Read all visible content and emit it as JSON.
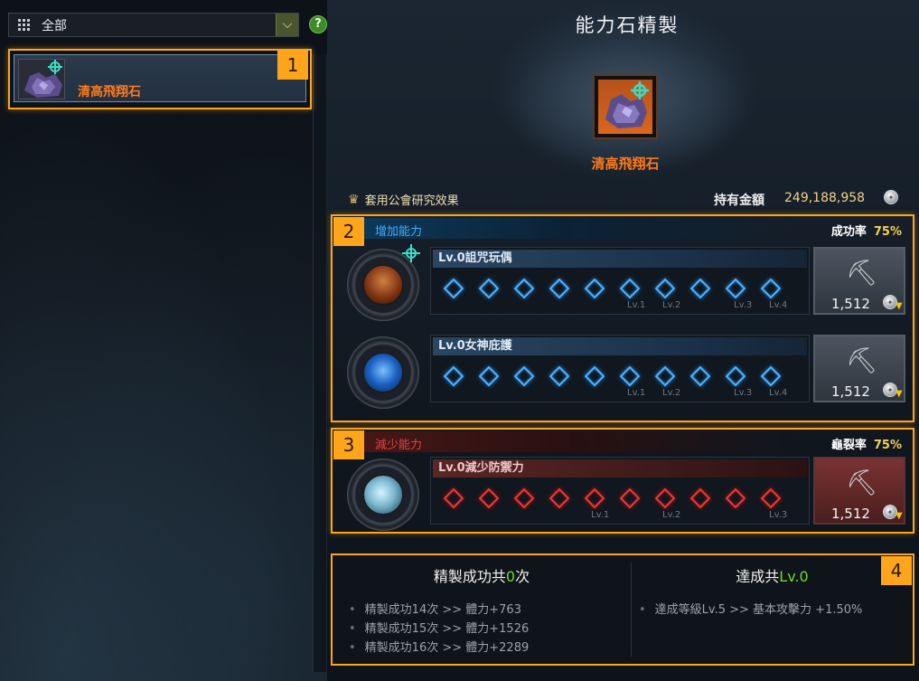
{
  "filter": {
    "label": "全部",
    "dropdown_icon": "chevron-down-icon",
    "help": "?"
  },
  "list": {
    "items": [
      {
        "name": "清高飛翔石",
        "badge": "1"
      }
    ]
  },
  "header": {
    "title": "能力石精製",
    "stone_name": "清高飛翔石",
    "guild_label": "套用公會研究效果",
    "money_label": "持有金額",
    "money_value": "249,188,958"
  },
  "increase": {
    "badge": "2",
    "label": "增加能力",
    "rate_label": "成功率",
    "rate_value": "75%",
    "rows": [
      {
        "name": "Lv.0詛咒玩偶",
        "cost": "1,512",
        "levels": [
          "Lv.1",
          "Lv.2",
          "Lv.3",
          "Lv.4"
        ]
      },
      {
        "name": "Lv.0女神庇護",
        "cost": "1,512",
        "levels": [
          "Lv.1",
          "Lv.2",
          "Lv.3",
          "Lv.4"
        ]
      }
    ]
  },
  "decrease": {
    "badge": "3",
    "label": "減少能力",
    "rate_label": "龜裂率",
    "rate_value": "75%",
    "rows": [
      {
        "name": "Lv.0減少防禦力",
        "cost": "1,512",
        "levels": [
          "Lv.1",
          "Lv.2",
          "Lv.3"
        ]
      }
    ]
  },
  "summary": {
    "badge": "4",
    "left": {
      "title_prefix": "精製成功共",
      "title_count": "0",
      "title_suffix": "次",
      "items": [
        "精製成功14次 >> 體力+763",
        "精製成功15次 >> 體力+1526",
        "精製成功16次 >> 體力+2289"
      ]
    },
    "right": {
      "title_prefix": "達成共",
      "title_level": "Lv.0",
      "items": [
        "達成等級Lv.5 >> 基本攻擊力 +1.50%"
      ]
    }
  },
  "colors": {
    "accent": "#ffa51c",
    "item_name": "#ff7a1a",
    "rate": "#f2d15a",
    "success_green": "#6fdb2c",
    "gem_blue": "#4fb4ff",
    "gem_red": "#e83a3a"
  }
}
